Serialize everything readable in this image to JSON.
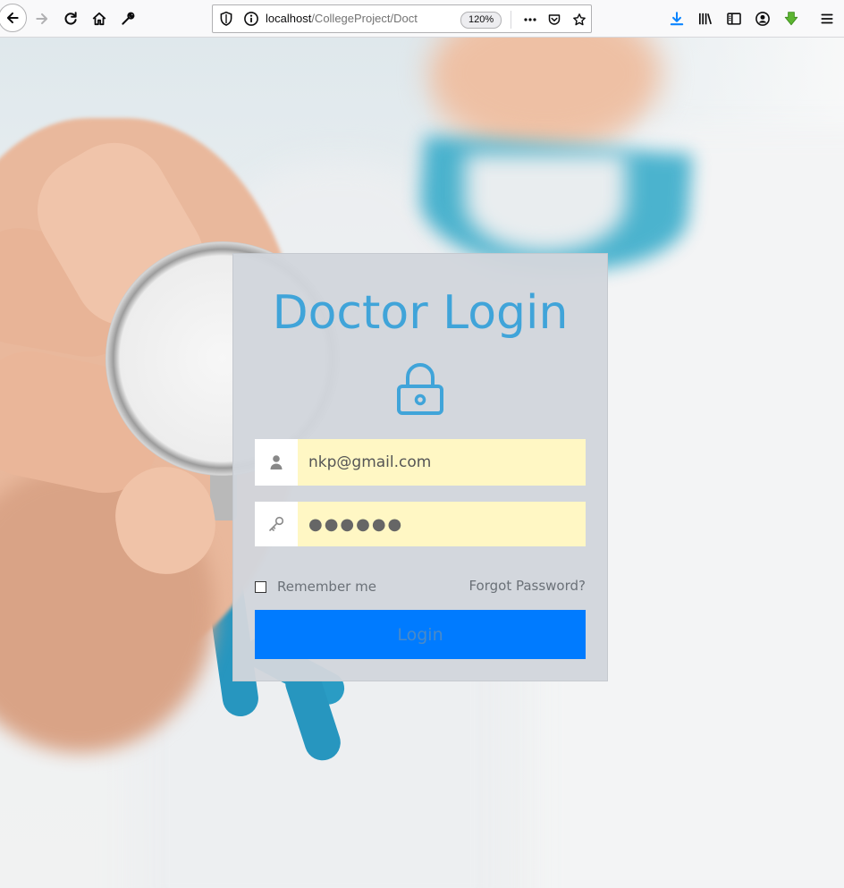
{
  "browser": {
    "url_host": "localhost",
    "url_path": "/CollegeProject/Doct",
    "zoom_level": "120%"
  },
  "login": {
    "title": "Doctor Login",
    "email_value": "nkp@gmail.com",
    "password_value": "●●●●●●",
    "remember_label": "Remember me",
    "forgot_label": "Forgot Password?",
    "login_button": "Login"
  },
  "colors": {
    "title": "#40a4d9",
    "input_bg": "#fff7c4",
    "login_button": "#007bff",
    "panel_bg": "#d1d5dc"
  },
  "icons": {
    "lock": "lock-icon",
    "user": "user-icon",
    "key": "key-icon"
  }
}
